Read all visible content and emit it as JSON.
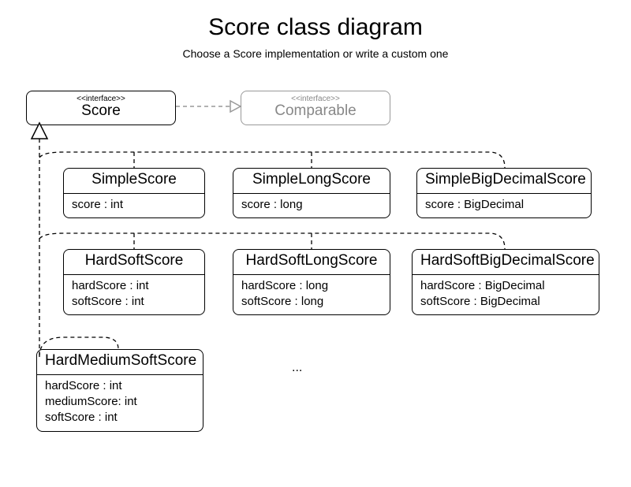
{
  "title": "Score class diagram",
  "subtitle": "Choose a Score implementation or write a custom one",
  "interfaces": {
    "score": {
      "stereotype": "<<interface>>",
      "name": "Score"
    },
    "comparable": {
      "stereotype": "<<interface>>",
      "name": "Comparable"
    }
  },
  "classes": {
    "simpleScore": {
      "name": "SimpleScore",
      "fields": [
        "score : int"
      ]
    },
    "simpleLongScore": {
      "name": "SimpleLongScore",
      "fields": [
        "score : long"
      ]
    },
    "simpleBigDecimalScore": {
      "name": "SimpleBigDecimalScore",
      "fields": [
        "score : BigDecimal"
      ]
    },
    "hardSoftScore": {
      "name": "HardSoftScore",
      "fields": [
        "hardScore : int",
        "softScore : int"
      ]
    },
    "hardSoftLongScore": {
      "name": "HardSoftLongScore",
      "fields": [
        "hardScore : long",
        "softScore : long"
      ]
    },
    "hardSoftBigDecimalScore": {
      "name": "HardSoftBigDecimalScore",
      "fields": [
        "hardScore : BigDecimal",
        "softScore : BigDecimal"
      ]
    },
    "hardMediumSoftScore": {
      "name": "HardMediumSoftScore",
      "fields": [
        "hardScore : int",
        "mediumScore: int",
        "softScore : int"
      ]
    }
  },
  "ellipsis": "..."
}
